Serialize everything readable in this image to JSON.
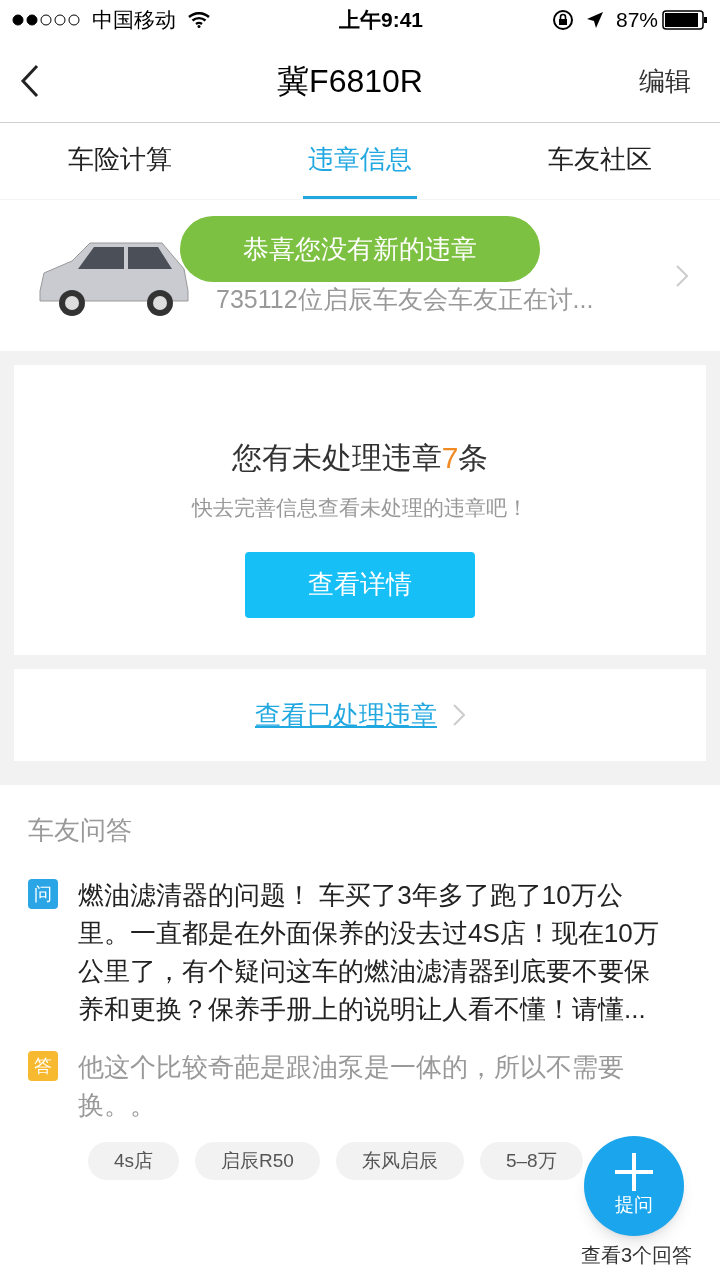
{
  "status_bar": {
    "carrier": "中国移动",
    "time": "上午9:41",
    "battery": "87%"
  },
  "nav": {
    "title": "冀F6810R",
    "action": "编辑"
  },
  "tabs": [
    {
      "label": "车险计算",
      "selected": false
    },
    {
      "label": "违章信息",
      "selected": true
    },
    {
      "label": "车友社区",
      "selected": false
    }
  ],
  "car": {
    "subtitle": "735112位启辰车友会车友正在讨..."
  },
  "toast": "恭喜您没有新的违章",
  "violations": {
    "title_before": "您有未处理违章",
    "count": "7",
    "title_after": "条",
    "hint": "快去完善信息查看未处理的违章吧！",
    "button": "查看详情"
  },
  "processed_link": "查看已处理违章",
  "qa": {
    "heading": "车友问答",
    "question_badge": "问",
    "question": "燃油滤清器的问题！ 车买了3年多了跑了10万公里。一直都是在外面保养的没去过4S店！现在10万公里了，有个疑问这车的燃油滤清器到底要不要保养和更换？保养手册上的说明让人看不懂！请懂...",
    "answer_badge": "答",
    "answer": "他这个比较奇葩是跟油泵是一体的，所以不需要换。。",
    "tags": [
      "4s店",
      "启辰R50",
      "东风启辰",
      "5–8万"
    ],
    "more": "查看3个回答"
  },
  "fab": {
    "label": "提问"
  }
}
